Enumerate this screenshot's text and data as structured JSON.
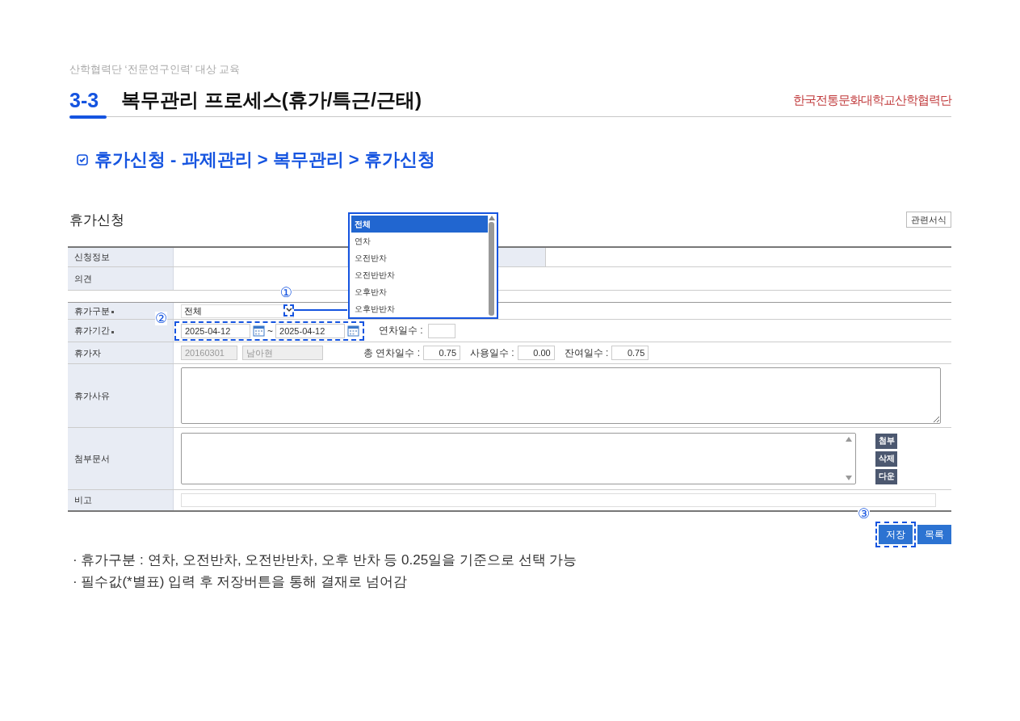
{
  "header": {
    "subtitle": "산학협력단 ‘전문연구인력’ 대상 교육",
    "number": "3-3",
    "title": "복무관리 프로세스(휴가/특근/근태)",
    "logo": "한국전통문화대학교산학협력단"
  },
  "section": {
    "title": "휴가신청 - 과제관리 > 복무관리 > 휴가신청"
  },
  "form": {
    "title": "휴가신청",
    "forms_button": "관련서식",
    "rows": [
      {
        "label": "신청정보",
        "required": false,
        "kind": "info"
      },
      {
        "label": "의견",
        "required": false,
        "kind": "blank"
      },
      {
        "label": "휴가구분",
        "required": true,
        "kind": "select",
        "value": "전체",
        "callout": "①"
      },
      {
        "label": "휴가기간",
        "required": true,
        "kind": "period",
        "start": "2025-04-12",
        "separator": "~",
        "end": "2025-04-12",
        "extra_label": "연차일수 :",
        "callout": "②"
      },
      {
        "label": "휴가자",
        "required": false,
        "kind": "person",
        "fields": [
          {
            "value": "20160301",
            "disabled": true
          },
          {
            "value": "남아현",
            "disabled": true
          }
        ],
        "stats": [
          {
            "label": "총 연차일수 :",
            "value": "0.75"
          },
          {
            "label": "사용일수 :",
            "value": "0.00"
          },
          {
            "label": "잔여일수 :",
            "value": "0.75"
          }
        ]
      },
      {
        "label": "휴가사유",
        "required": false,
        "kind": "textarea"
      },
      {
        "label": "첨부문서",
        "required": false,
        "kind": "attachment",
        "buttons": [
          "첨부",
          "삭제",
          "다운"
        ]
      },
      {
        "label": "비고",
        "required": false,
        "kind": "input"
      }
    ],
    "dropdown": {
      "options": [
        {
          "label": "전체",
          "selected": true
        },
        {
          "label": "연차",
          "selected": false
        },
        {
          "label": "오전반차",
          "selected": false
        },
        {
          "label": "오전반반차",
          "selected": false
        },
        {
          "label": "오후반차",
          "selected": false
        },
        {
          "label": "오후반반차",
          "selected": false
        }
      ]
    },
    "actions": [
      {
        "label": "저장",
        "callout": "③"
      },
      {
        "label": "목록"
      }
    ]
  },
  "notes": [
    "· 휴가구분 : 연차, 오전반차, 오전반반차, 오후 반차 등 0.25일을 기준으로 선택 가능",
    "· 필수값(*별표) 입력 후 저장버튼을 통해 결재로 넘어감"
  ]
}
